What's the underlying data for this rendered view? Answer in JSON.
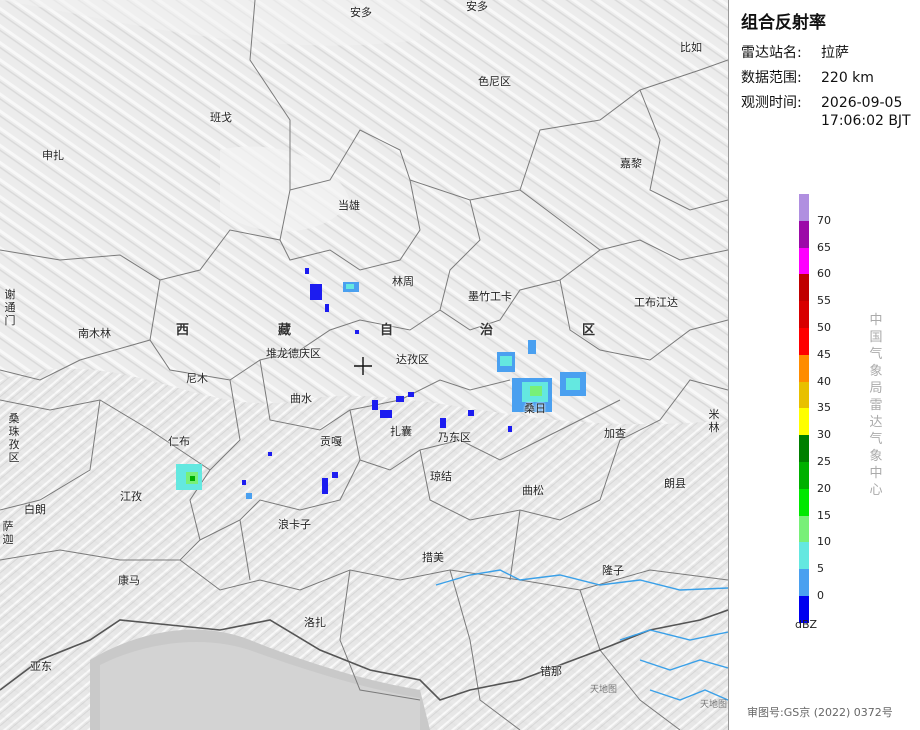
{
  "panel": {
    "title": "组合反射率",
    "station_label": "雷达站名:",
    "station_value": "拉萨",
    "range_label": "数据范围:",
    "range_value": "220 km",
    "time_label": "观测时间:",
    "time_date": "2026-09-05",
    "time_clock": "17:06:02 BJT"
  },
  "legend": {
    "unit": "dBZ",
    "colors": [
      "#b08fe0",
      "#9c0aa8",
      "#ff00ff",
      "#c00000",
      "#d80000",
      "#ff0000",
      "#ff8c00",
      "#e8c000",
      "#ffff00",
      "#007f00",
      "#00b000",
      "#00e800",
      "#78f078",
      "#64e8e0",
      "#4aa0f0",
      "#0000f0"
    ],
    "labels": [
      "70",
      "65",
      "60",
      "55",
      "50",
      "45",
      "40",
      "35",
      "30",
      "25",
      "20",
      "15",
      "10",
      "5",
      "0"
    ]
  },
  "organization_text": "中国气象局雷达气象中心",
  "review_number": "审图号:GS京 (2022) 0372号",
  "watermark_texts": [
    "天地图",
    "天地图"
  ],
  "region_name": [
    "西",
    "藏",
    "自",
    "治",
    "区"
  ],
  "places": [
    "安多",
    "安多",
    "色尼区",
    "比如",
    "班戈",
    "申扎",
    "嘉黎",
    "当雄",
    "林周",
    "墨竹工卡",
    "工布江达",
    "谢通门",
    "南木林",
    "堆龙德庆区",
    "达孜区",
    "尼木",
    "曲水",
    "扎囊",
    "乃东区",
    "桑日",
    "加查",
    "米林",
    "桑珠孜区",
    "仁布",
    "贡嘎",
    "琼结",
    "曲松",
    "朗县",
    "白朗",
    "江孜",
    "康马",
    "浪卡子",
    "措美",
    "隆子",
    "洛扎",
    "亚东",
    "错那",
    "萨迦"
  ]
}
